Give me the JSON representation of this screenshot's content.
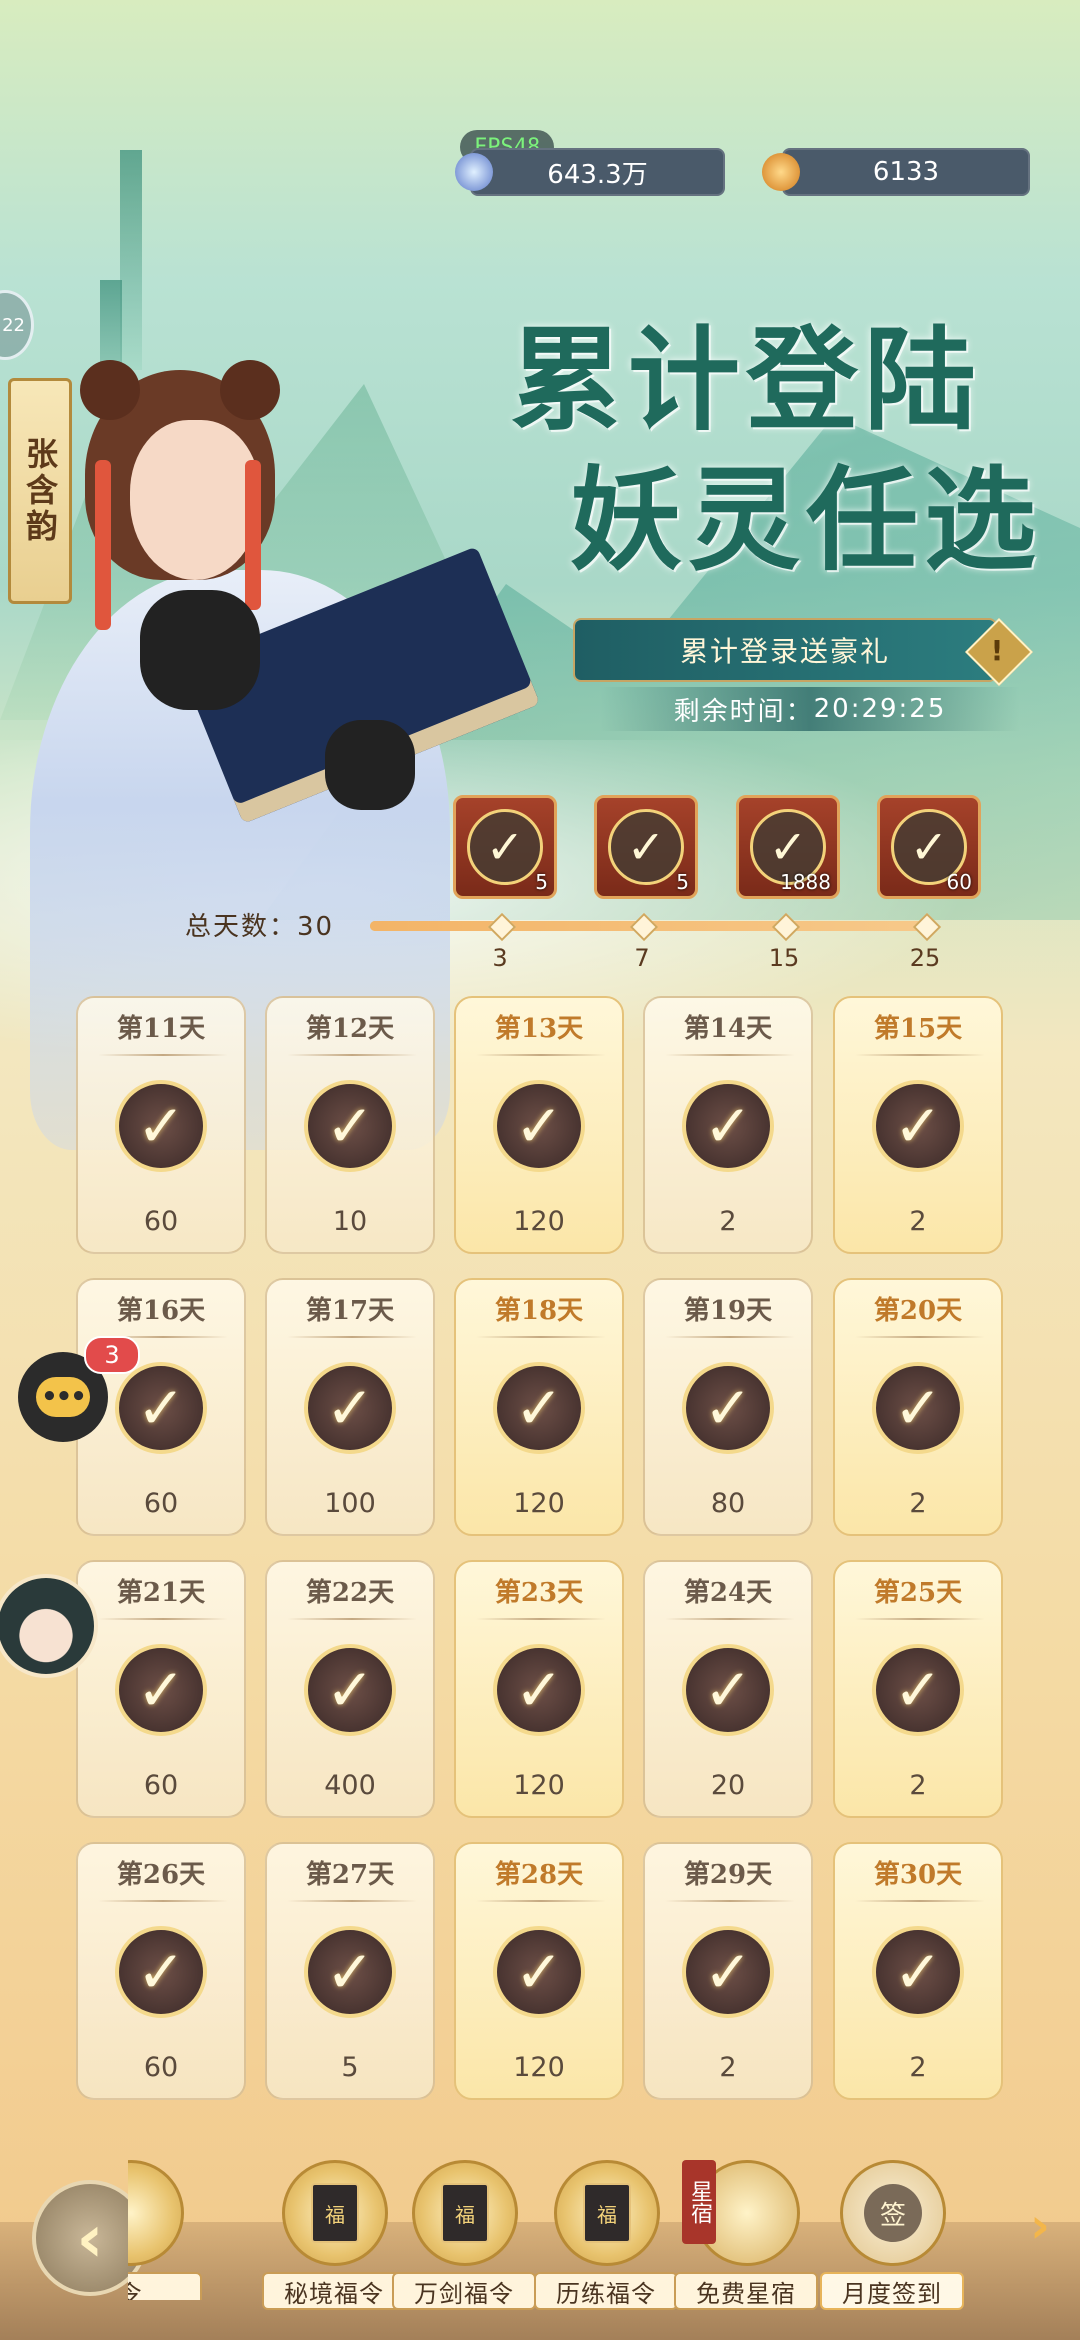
{
  "header": {
    "fps_label": "FPS48",
    "currency_1": {
      "value": "643.3万",
      "icon": "jade-coin-icon"
    },
    "currency_2": {
      "value": "6133",
      "icon": "gold-ingot-icon"
    }
  },
  "title": {
    "line1": "累计登陆",
    "line2": "妖灵任选"
  },
  "banner": {
    "label": "累计登录送豪礼",
    "icon": "info-diamond-icon"
  },
  "timer": {
    "label": "剩余时间：",
    "value": "20:29:25"
  },
  "character": {
    "name": "张含韵"
  },
  "side_circle_label": "22",
  "milestones": {
    "total_label": "总天数：",
    "total_value": "30",
    "items": [
      {
        "day": "3",
        "count": "5",
        "claimed": true
      },
      {
        "day": "7",
        "count": "5",
        "claimed": true
      },
      {
        "day": "15",
        "count": "1888",
        "claimed": true
      },
      {
        "day": "25",
        "count": "60",
        "claimed": true
      }
    ]
  },
  "days": [
    {
      "title": "第11天",
      "qty": "60",
      "gold": false
    },
    {
      "title": "第12天",
      "qty": "10",
      "gold": false
    },
    {
      "title": "第13天",
      "qty": "120",
      "gold": true
    },
    {
      "title": "第14天",
      "qty": "2",
      "gold": false
    },
    {
      "title": "第15天",
      "qty": "2",
      "gold": true
    },
    {
      "title": "第16天",
      "qty": "60",
      "gold": false
    },
    {
      "title": "第17天",
      "qty": "100",
      "gold": false
    },
    {
      "title": "第18天",
      "qty": "120",
      "gold": true
    },
    {
      "title": "第19天",
      "qty": "80",
      "gold": false
    },
    {
      "title": "第20天",
      "qty": "2",
      "gold": true
    },
    {
      "title": "第21天",
      "qty": "60",
      "gold": false
    },
    {
      "title": "第22天",
      "qty": "400",
      "gold": false
    },
    {
      "title": "第23天",
      "qty": "120",
      "gold": true
    },
    {
      "title": "第24天",
      "qty": "20",
      "gold": false
    },
    {
      "title": "第25天",
      "qty": "2",
      "gold": true
    },
    {
      "title": "第26天",
      "qty": "60",
      "gold": false
    },
    {
      "title": "第27天",
      "qty": "5",
      "gold": false
    },
    {
      "title": "第28天",
      "qty": "120",
      "gold": true
    },
    {
      "title": "第29天",
      "qty": "2",
      "gold": false
    },
    {
      "title": "第30天",
      "qty": "2",
      "gold": true
    }
  ],
  "chat": {
    "badge": "3",
    "icon": "chat-bubble-icon",
    "dots": "•••"
  },
  "nav": {
    "partial_label": "令",
    "items": [
      {
        "label": "秘境福令",
        "icon_text": "福"
      },
      {
        "label": "万剑福令",
        "icon_text": "福"
      },
      {
        "label": "历练福令",
        "icon_text": "福"
      },
      {
        "label": "免费星宿",
        "icon_text": ""
      },
      {
        "label": "月度签到",
        "icon_text": "签"
      }
    ],
    "xingxiu_tag": "星宿",
    "back_glyph": "‹",
    "next_glyph": "›"
  },
  "check_glyph": "✓"
}
